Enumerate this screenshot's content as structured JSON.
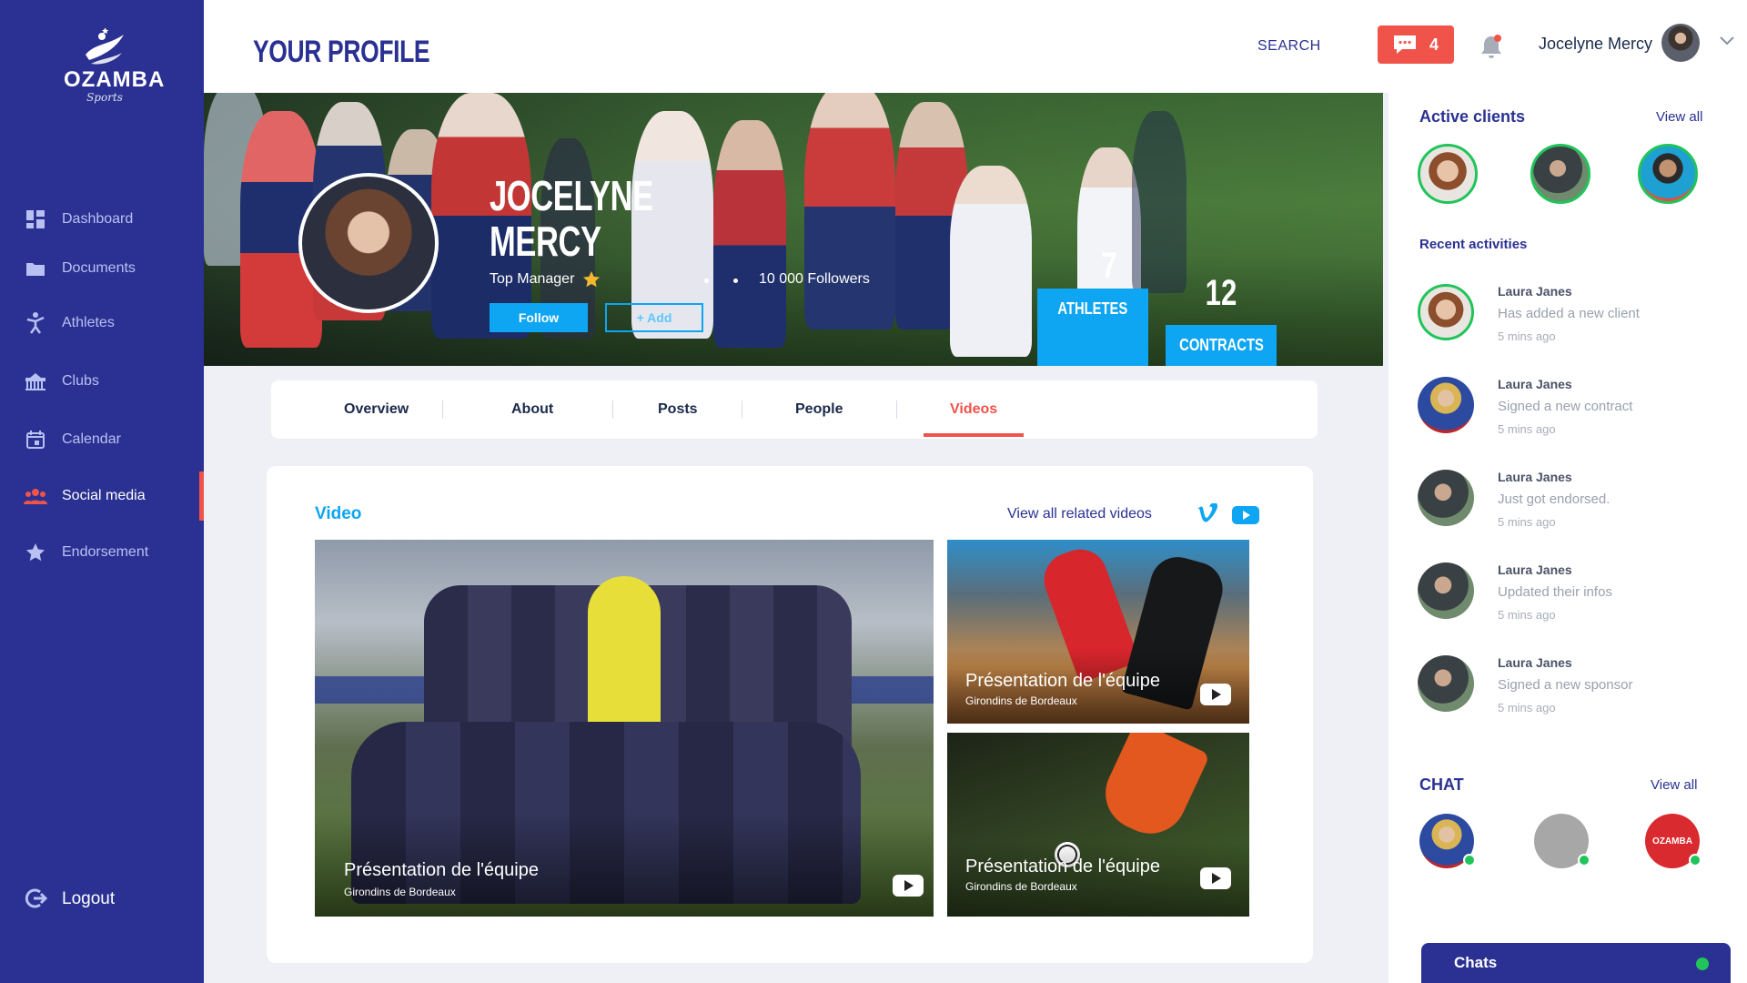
{
  "colors": {
    "sidebar": "#2a3192",
    "accent_blue": "#0ea5f2",
    "accent_red": "#f0534a",
    "online_green": "#21c45a"
  },
  "brand": {
    "name": "OZAMBA",
    "tagline": "Sports"
  },
  "sidebar": {
    "items": [
      {
        "label": "Dashboard",
        "icon": "dashboard-icon"
      },
      {
        "label": "Documents",
        "icon": "folder-icon"
      },
      {
        "label": "Athletes",
        "icon": "athlete-icon"
      },
      {
        "label": "Clubs",
        "icon": "stadium-icon"
      },
      {
        "label": "Calendar",
        "icon": "calendar-icon"
      },
      {
        "label": "Social media",
        "icon": "people-icon",
        "active": true
      },
      {
        "label": "Endorsement",
        "icon": "star-icon"
      }
    ],
    "logout_label": "Logout"
  },
  "header": {
    "title": "YOUR PROFILE",
    "search_label": "SEARCH",
    "messages_count": "4",
    "user_name": "Jocelyne Mercy"
  },
  "profile": {
    "name_line1": "JOCELYNE",
    "name_line2": "MERCY",
    "role": "Top Manager",
    "followers": "10 000 Followers",
    "follow_label": "Follow",
    "add_label": "+ Add",
    "athletes_count": "7",
    "athletes_label": "ATHLETES",
    "contracts_count": "12",
    "contracts_label": "CONTRACTS"
  },
  "tabs": [
    {
      "label": "Overview"
    },
    {
      "label": "About"
    },
    {
      "label": "Posts"
    },
    {
      "label": "People"
    },
    {
      "label": "Videos",
      "active": true
    }
  ],
  "videos": {
    "title": "Video",
    "view_all_label": "View all related videos",
    "items": [
      {
        "title": "Présentation de l'équipe",
        "subtitle": "Girondins de Bordeaux"
      },
      {
        "title": "Présentation de l'équipe",
        "subtitle": "Girondins de Bordeaux"
      },
      {
        "title": "Présentation de l'équipe",
        "subtitle": "Girondins de Bordeaux"
      }
    ]
  },
  "right_panel": {
    "active_clients_title": "Active clients",
    "active_clients_view_all": "View all",
    "recent_title": "Recent activities",
    "activities": [
      {
        "name": "Laura Janes",
        "desc": "Has added a new client",
        "time": "5 mins ago"
      },
      {
        "name": "Laura Janes",
        "desc": "Signed a new contract",
        "time": "5 mins ago"
      },
      {
        "name": "Laura Janes",
        "desc": "Just got endorsed.",
        "time": "5 mins ago"
      },
      {
        "name": "Laura Janes",
        "desc": "Updated their infos",
        "time": "5 mins ago"
      },
      {
        "name": "Laura Janes",
        "desc": "Signed a new sponsor",
        "time": "5 mins ago"
      }
    ],
    "chat_title": "CHAT",
    "chat_view_all": "View all",
    "chat_logo_text": "OZAMBA",
    "chats_bar_label": "Chats"
  }
}
